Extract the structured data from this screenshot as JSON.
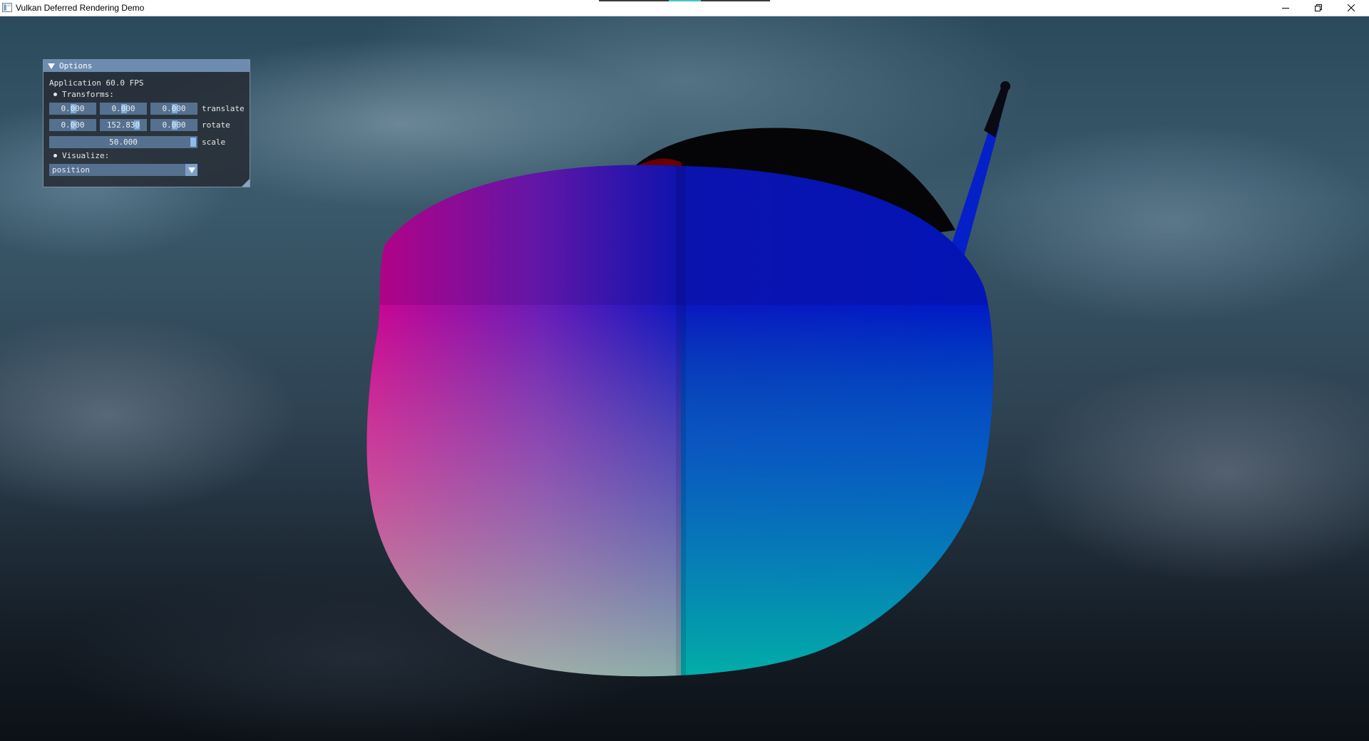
{
  "window": {
    "title": "Vulkan Deferred Rendering Demo",
    "controls": [
      "minimize",
      "restore",
      "close"
    ]
  },
  "options_panel": {
    "header": "Options",
    "fps_text": "Application 60.0 FPS",
    "transforms_label": "Transforms:",
    "translate": {
      "x": "0.000",
      "y": "0.000",
      "z": "0.000",
      "label": "translate"
    },
    "rotate": {
      "x": "0.000",
      "y": "152.830",
      "z": "0.000",
      "label": "rotate"
    },
    "scale": {
      "value": "50.000",
      "label": "scale"
    },
    "visualize_label": "Visualize:",
    "visualize_selected": "position"
  },
  "scene": {
    "model_coloring": "position",
    "colors": {
      "magenta": "#d4008f",
      "blue": "#0015c8",
      "teal": "#00b3a4",
      "peach": "#c8b49c"
    }
  }
}
